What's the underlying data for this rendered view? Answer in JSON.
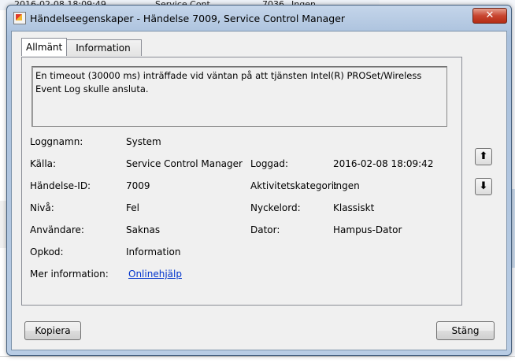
{
  "background": {
    "row_date": "2016-02-08 18:09:49",
    "row_source": "Service Cont...",
    "row_id": "7036",
    "row_cat": "Ingen"
  },
  "window": {
    "title": "Händelseegenskaper - Händelse 7009, Service Control Manager",
    "close_glyph": "✕"
  },
  "tabs": [
    {
      "label": "Allmänt"
    },
    {
      "label": "Information"
    }
  ],
  "description": "En timeout (30000 ms) inträffade vid väntan på att tjänsten Intel(R) PROSet/Wireless Event Log skulle ansluta.",
  "fields": {
    "logname": {
      "label": "Loggnamn:",
      "value": "System"
    },
    "source": {
      "label": "Källa:",
      "value": "Service Control Manager"
    },
    "logged": {
      "label": "Loggad:",
      "value": "2016-02-08 18:09:42"
    },
    "event_id": {
      "label": "Händelse-ID:",
      "value": "7009"
    },
    "task": {
      "label": "Aktivitetskategori:",
      "value": "Ingen"
    },
    "level": {
      "label": "Nivå:",
      "value": "Fel"
    },
    "keywords": {
      "label": "Nyckelord:",
      "value": "Klassiskt"
    },
    "user": {
      "label": "Användare:",
      "value": "Saknas"
    },
    "computer": {
      "label": "Dator:",
      "value": "Hampus-Dator"
    },
    "opcode": {
      "label": "Opkod:",
      "value": "Information"
    },
    "more_info": {
      "label": "Mer information:",
      "value": "Onlinehjälp"
    }
  },
  "nav": {
    "up_glyph": "⬆",
    "down_glyph": "⬇"
  },
  "buttons": {
    "copy": "Kopiera",
    "close": "Stäng"
  }
}
